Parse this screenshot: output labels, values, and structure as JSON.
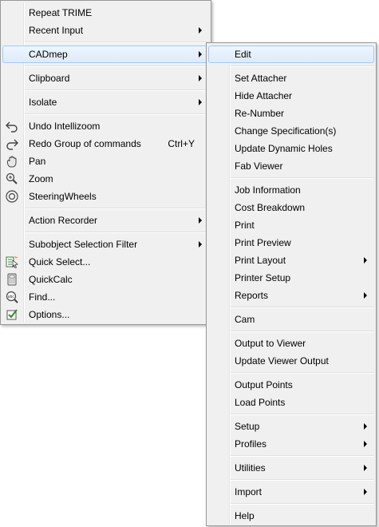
{
  "main_menu": {
    "repeat_trime": "Repeat TRIME",
    "recent_input": "Recent Input",
    "cadmep": "CADmep",
    "clipboard": "Clipboard",
    "isolate": "Isolate",
    "undo": "Undo Intellizoom",
    "redo": "Redo Group of commands",
    "redo_shortcut": "Ctrl+Y",
    "pan": "Pan",
    "zoom": "Zoom",
    "steering_wheels": "SteeringWheels",
    "action_recorder": "Action Recorder",
    "subobject_filter": "Subobject Selection Filter",
    "quick_select": "Quick Select...",
    "quickcalc": "QuickCalc",
    "find": "Find...",
    "options": "Options..."
  },
  "cadmep_submenu": {
    "edit": "Edit",
    "set_attacher": "Set Attacher",
    "hide_attacher": "Hide Attacher",
    "re_number": "Re-Number",
    "change_spec": "Change Specification(s)",
    "update_holes": "Update Dynamic Holes",
    "fab_viewer": "Fab Viewer",
    "job_information": "Job Information",
    "cost_breakdown": "Cost Breakdown",
    "print": "Print",
    "print_preview": "Print Preview",
    "print_layout": "Print Layout",
    "printer_setup": "Printer Setup",
    "reports": "Reports",
    "cam": "Cam",
    "output_to_viewer": "Output to Viewer",
    "update_viewer_output": "Update Viewer Output",
    "output_points": "Output Points",
    "load_points": "Load Points",
    "setup": "Setup",
    "profiles": "Profiles",
    "utilities": "Utilities",
    "import": "Import",
    "help": "Help"
  }
}
